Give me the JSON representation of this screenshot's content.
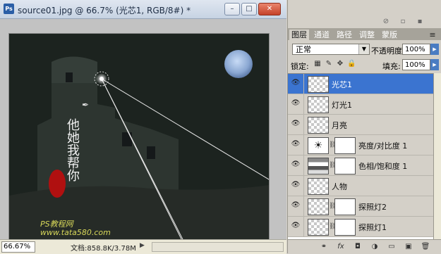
{
  "document": {
    "app_icon": "Ps",
    "title": "source01.jpg @ 66.7% (光芯1, RGB/8#) *",
    "window_buttons": {
      "minimize": "–",
      "maximize": "□",
      "close": "✕"
    },
    "zoom": "66.67%",
    "doc_size": "文档:858.8K/3.78M",
    "status_arrow": "▶"
  },
  "panel": {
    "tabs": [
      "图层",
      "通道",
      "路径",
      "调整",
      "蒙版"
    ],
    "active_tab": 0,
    "blend_mode": "正常",
    "opacity_label": "不透明度:",
    "opacity_value": "100%",
    "lock_label": "锁定:",
    "fill_label": "填充:",
    "fill_value": "100%",
    "layers": [
      {
        "name": "光芯1",
        "selected": true
      },
      {
        "name": "灯光1"
      },
      {
        "name": "月亮"
      },
      {
        "name": "亮度/对比度 1"
      },
      {
        "name": "色相/饱和度 1"
      },
      {
        "name": "人物"
      },
      {
        "name": "探照灯2"
      },
      {
        "name": "探照灯1"
      }
    ],
    "bottom_icons": [
      "link-layers-icon",
      "fx-icon",
      "add-mask-icon",
      "adjustment-icon",
      "group-icon",
      "new-layer-icon",
      "trash-icon"
    ],
    "bottom_glyphs": [
      "⚭",
      "fx",
      "◘",
      "◑",
      "▭",
      "▣",
      "🗑"
    ]
  },
  "canvas": {
    "watermark_line1": "PS教程网",
    "watermark_line2": "www.tata580.com",
    "calligraphy": "他她我帮你"
  },
  "colors": {
    "selection": "#3b74d0",
    "canvas_bg": "#1d2420",
    "moon": "#a9c2e6"
  }
}
